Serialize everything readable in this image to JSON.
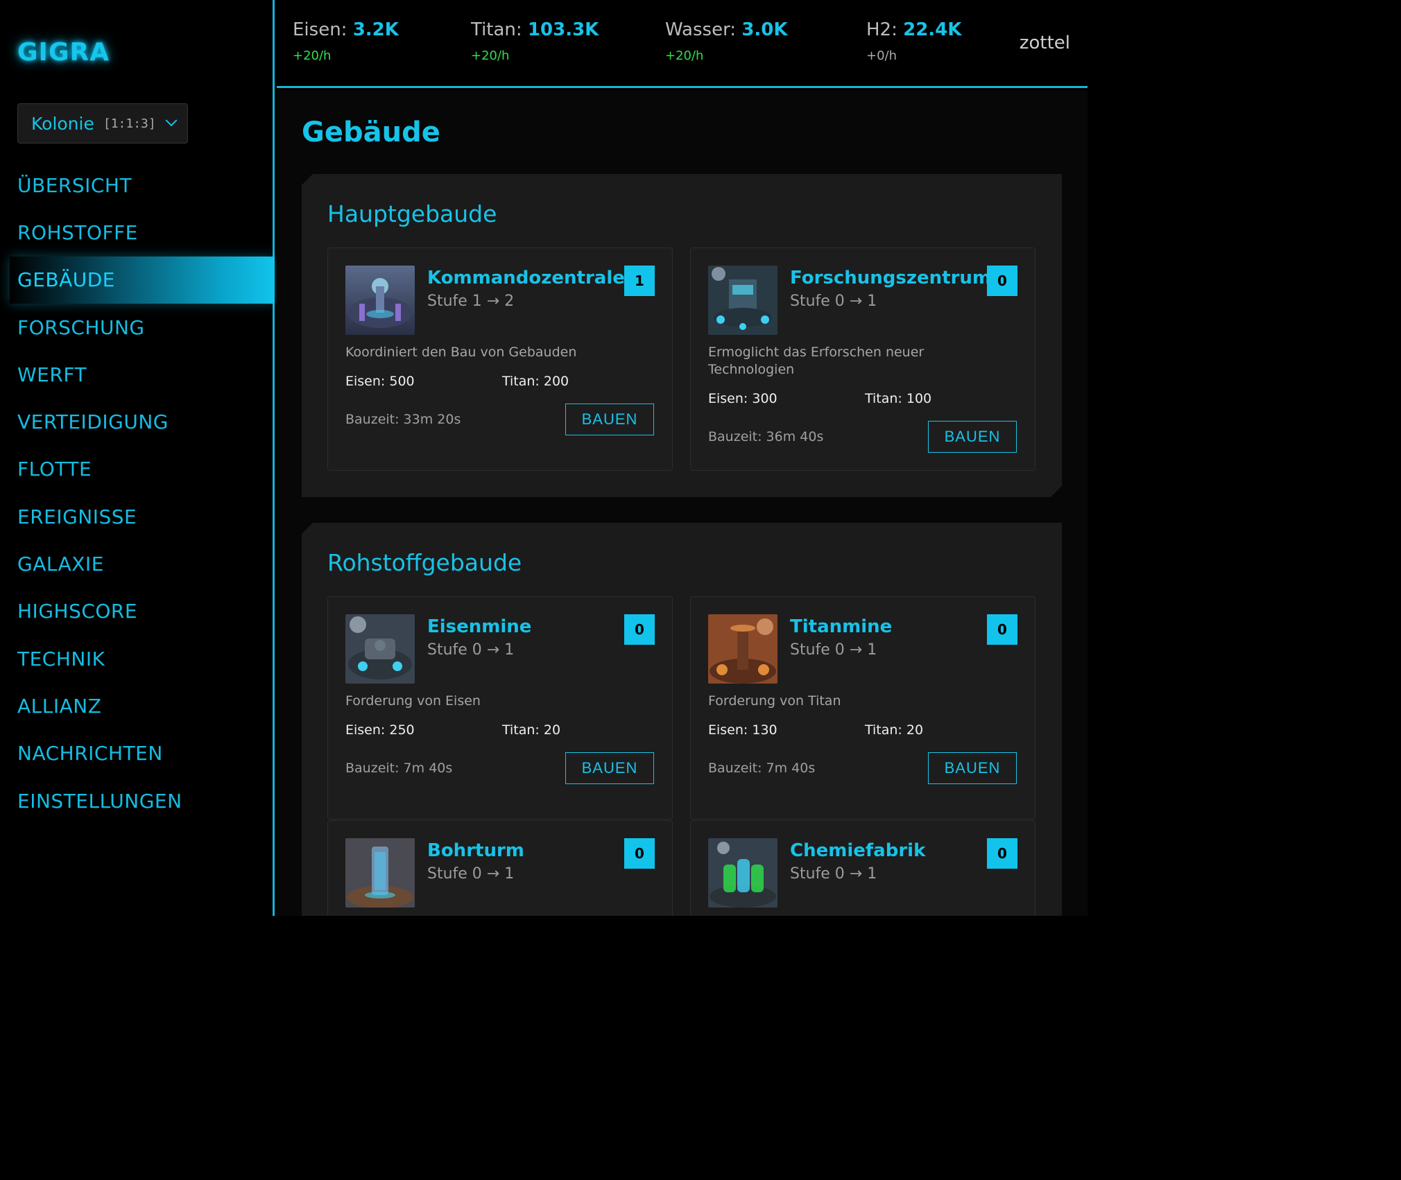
{
  "app": {
    "logo": "GIGRA"
  },
  "colony": {
    "name": "Kolonie",
    "coords": "[1:1:3]"
  },
  "nav": [
    {
      "label": "ÜBERSICHT"
    },
    {
      "label": "ROHSTOFFE"
    },
    {
      "label": "GEBÄUDE",
      "active": true
    },
    {
      "label": "FORSCHUNG"
    },
    {
      "label": "WERFT"
    },
    {
      "label": "VERTEIDIGUNG"
    },
    {
      "label": "FLOTTE"
    },
    {
      "label": "EREIGNISSE"
    },
    {
      "label": "GALAXIE"
    },
    {
      "label": "HIGHSCORE"
    },
    {
      "label": "TECHNIK"
    },
    {
      "label": "ALLIANZ"
    },
    {
      "label": "NACHRICHTEN"
    },
    {
      "label": "EINSTELLUNGEN"
    }
  ],
  "resources": [
    {
      "name": "Eisen:",
      "value": "3.2K",
      "rate": "+20/h"
    },
    {
      "name": "Titan:",
      "value": "103.3K",
      "rate": "+20/h"
    },
    {
      "name": "Wasser:",
      "value": "3.0K",
      "rate": "+20/h"
    },
    {
      "name": "H2:",
      "value": "22.4K",
      "rate": "+0/h"
    }
  ],
  "user": {
    "name": "zottel"
  },
  "page": {
    "title": "Gebäude"
  },
  "sections": [
    {
      "title": "Hauptgebaude",
      "buildings": [
        {
          "name": "Kommandozentrale",
          "level": "Stufe 1 → 2",
          "badge": "1",
          "description": "Koordiniert den Bau von Gebauden",
          "cost_eisen": "Eisen: 500",
          "cost_titan": "Titan: 200",
          "build_time": "Bauzeit: 33m 20s",
          "button": "BAUEN"
        },
        {
          "name": "Forschungszentrum",
          "level": "Stufe 0 → 1",
          "badge": "0",
          "description": "Ermoglicht das Erforschen neuer Technologien",
          "cost_eisen": "Eisen: 300",
          "cost_titan": "Titan: 100",
          "build_time": "Bauzeit: 36m 40s",
          "button": "BAUEN"
        }
      ]
    },
    {
      "title": "Rohstoffgebaude",
      "buildings": [
        {
          "name": "Eisenmine",
          "level": "Stufe 0 → 1",
          "badge": "0",
          "description": "Forderung von Eisen",
          "cost_eisen": "Eisen: 250",
          "cost_titan": "Titan: 20",
          "build_time": "Bauzeit: 7m 40s",
          "button": "BAUEN"
        },
        {
          "name": "Titanmine",
          "level": "Stufe 0 → 1",
          "badge": "0",
          "description": "Forderung von Titan",
          "cost_eisen": "Eisen: 130",
          "cost_titan": "Titan: 20",
          "build_time": "Bauzeit: 7m 40s",
          "button": "BAUEN"
        },
        {
          "name": "Bohrturm",
          "level": "Stufe 0 → 1",
          "badge": "0"
        },
        {
          "name": "Chemiefabrik",
          "level": "Stufe 0 → 1",
          "badge": "0"
        }
      ]
    }
  ],
  "colors": {
    "accent": "#17c3e8",
    "rate_positive": "#2fe04a",
    "panel": "#1b1b1b"
  }
}
